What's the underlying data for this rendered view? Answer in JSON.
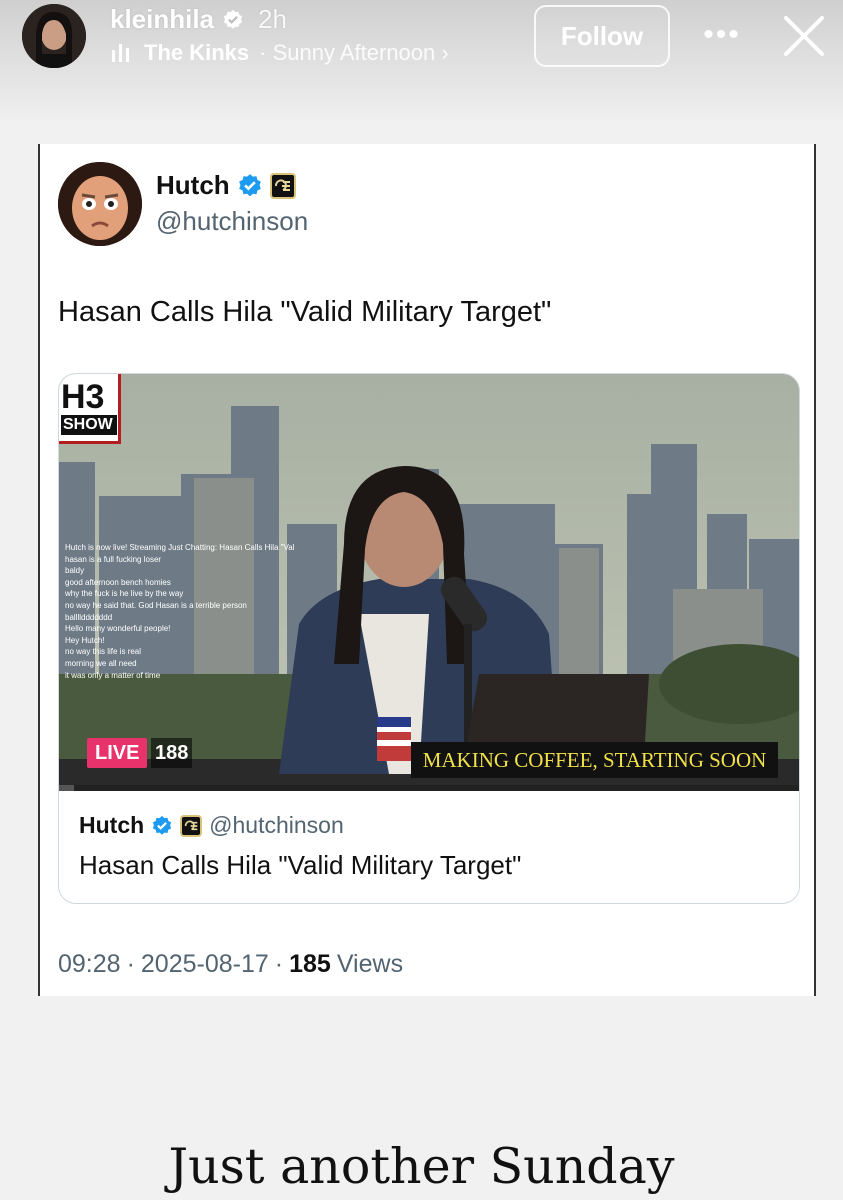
{
  "story_header": {
    "username": "kleinhila",
    "time": "2h",
    "music_artist": "The Kinks",
    "music_song": "· Sunny Afternoon ›",
    "follow_label": "Follow",
    "more_label": "•••"
  },
  "tweet": {
    "display_name": "Hutch",
    "handle": "@hutchinson",
    "text": "Hasan Calls Hila \"Valid Military Target\"",
    "media": {
      "logo_top": "H3",
      "logo_bottom": "SHOW",
      "live_label": "LIVE",
      "viewer_count": "188",
      "banner": "MAKING COFFEE, STARTING SOON",
      "progress": 0.02,
      "chat": [
        {
          "user": "",
          "msg": "Hutch is now live! Streaming Just Chatting: Hasan Calls Hila \"Valid Military Target\""
        },
        {
          "user": "",
          "msg": "hasan is a full fucking loser"
        },
        {
          "user": "",
          "msg": "baldy"
        },
        {
          "user": "",
          "msg": "good afternoon bench homies"
        },
        {
          "user": "",
          "msg": "why the fuck is he live by the way"
        },
        {
          "user": "",
          "msg": "no way he said that. God Hasan is a terrible person"
        },
        {
          "user": "",
          "msg": "ballllddddddd"
        },
        {
          "user": "",
          "msg": "Hello many wonderful people!"
        },
        {
          "user": "",
          "msg": "Hey Hutch!"
        },
        {
          "user": "",
          "msg": "no way this life is real"
        },
        {
          "user": "",
          "msg": "morning we all need"
        },
        {
          "user": "",
          "msg": "it was only a matter of time"
        }
      ]
    },
    "quote": {
      "display_name": "Hutch",
      "handle": "@hutchinson",
      "text": "Hasan Calls Hila \"Valid Military Target\""
    },
    "meta": {
      "time": "09:28",
      "sep1": "·",
      "date": "2025-08-17",
      "sep2": "·",
      "views_count": "185",
      "views_label": "Views"
    }
  },
  "caption": "Just another Sunday",
  "colors": {
    "verified_blue": "#1d9bf0",
    "live_pink": "#e8326b",
    "banner_text": "#f0e04a",
    "secondary_text": "#536471"
  }
}
